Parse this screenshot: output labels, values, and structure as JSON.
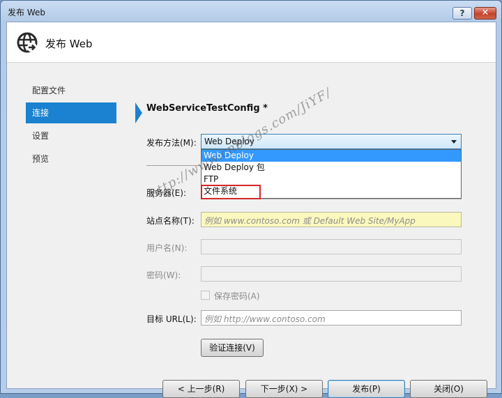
{
  "window": {
    "title": "发布 Web",
    "help_glyph": "?",
    "close_glyph": "✕"
  },
  "header": {
    "title": "发布 Web",
    "icon": "globe-publish-icon"
  },
  "sidebar": {
    "items": [
      {
        "label": "配置文件",
        "selected": false
      },
      {
        "label": "连接",
        "selected": true
      },
      {
        "label": "设置",
        "selected": false
      },
      {
        "label": "预览",
        "selected": false
      }
    ]
  },
  "form": {
    "config_title": "WebServiceTestConfig *",
    "publish_method_label": "发布方法(M):",
    "publish_method_value": "Web Deploy",
    "publish_method_options": [
      "Web Deploy",
      "Web Deploy 包",
      "FTP",
      "文件系统"
    ],
    "server_label": "服务器(E):",
    "site_label": "站点名称(T):",
    "site_placeholder": "例如 www.contoso.com 或 Default Web Site/MyApp",
    "username_label": "用户名(N):",
    "password_label": "密码(W):",
    "save_password_label": "保存密码(A)",
    "target_url_label": "目标 URL(L):",
    "target_url_placeholder": "例如 http://www.contoso.com",
    "validate_button": "验证连接(V)"
  },
  "footer": {
    "prev_button": "< 上一步(R)",
    "next_button": "下一步(X) >",
    "publish_button": "发布(P)",
    "close_button": "关闭(O)"
  },
  "watermark": "http://www.cnblogs.com/JiYF/",
  "colors": {
    "selected_nav": "#1a82d0",
    "highlight": "#3399ff",
    "annotation_box": "#d42626",
    "site_field_bg": "#fbf8bd"
  }
}
